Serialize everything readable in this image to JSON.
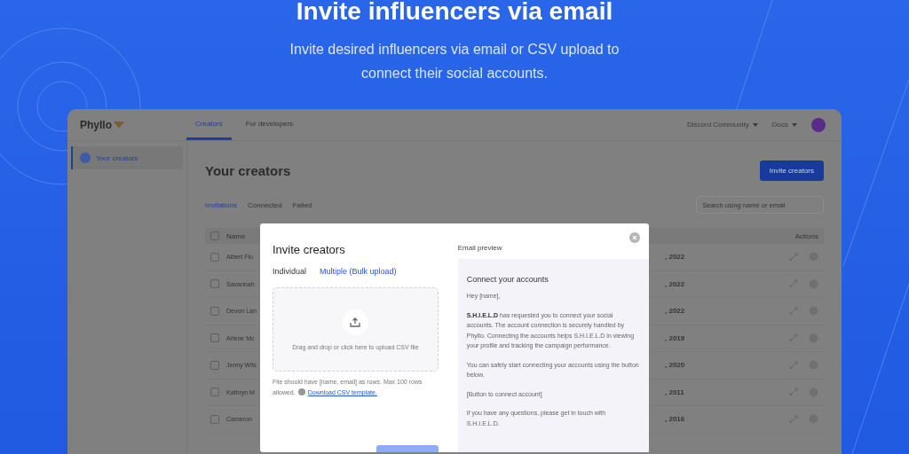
{
  "hero": {
    "title": "Invite influencers via email",
    "subtitle": "Invite desired influencers via email or CSV upload to connect their social accounts."
  },
  "app": {
    "logo": "Phyllo",
    "nav_tabs": [
      {
        "label": "Creators",
        "selected": true
      },
      {
        "label": "For developers",
        "selected": false
      }
    ],
    "header_links": [
      "Discord Community",
      "Docs"
    ],
    "sidebar": {
      "items": [
        {
          "label": "Your creators",
          "selected": true
        }
      ]
    },
    "page_title": "Your creators",
    "invite_button": "Invite creators",
    "sub_tabs": [
      {
        "label": "Invitations",
        "selected": true
      },
      {
        "label": "Connected",
        "selected": false
      },
      {
        "label": "Failed",
        "selected": false
      }
    ],
    "search": {
      "placeholder": "Search using name or email"
    },
    "table": {
      "columns": [
        "Name",
        "Actions"
      ],
      "all_checked": false,
      "rows": [
        {
          "name": "Albert Flo",
          "date": ", 2022",
          "checked": false
        },
        {
          "name": "Savannah",
          "date": ", 2022",
          "checked": false
        },
        {
          "name": "Devon Lan",
          "date": ", 2022",
          "checked": false
        },
        {
          "name": "Arlene Mc",
          "date": ", 2019",
          "checked": false
        },
        {
          "name": "Jenny Wils",
          "date": ", 2020",
          "checked": false
        },
        {
          "name": "Kathryn M",
          "date": ", 2011",
          "checked": false
        },
        {
          "name": "Cameron",
          "date": ", 2016",
          "checked": false
        }
      ]
    }
  },
  "modal": {
    "title": "Invite creators",
    "tabs": [
      {
        "label": "Individual",
        "selected": false
      },
      {
        "label": "Multiple (Bulk upload)",
        "selected": true
      }
    ],
    "dropzone": "Drag and drop or click here to upload CSV file",
    "hint": "File should have [name, email] as rows. Max 100 rows allowed.",
    "template_link": "Download CSV template.",
    "email_preview": {
      "label": "Email preview",
      "heading": "Connect your accounts",
      "paragraphs": [
        "Hey [name],",
        "**S.H.I.E.L.D** has requested you to connect your social accounts. The account connection is securely handled by Phyllo. Connecting the accounts helps S.H.I.E.L.D in viewing your profile and tracking the campaign performance.",
        "You can safely start connecting your accounts using the button below.",
        "[Button to connect account]",
        "If you have any questions, please get in touch with S.H.I.E.L.D."
      ]
    }
  }
}
